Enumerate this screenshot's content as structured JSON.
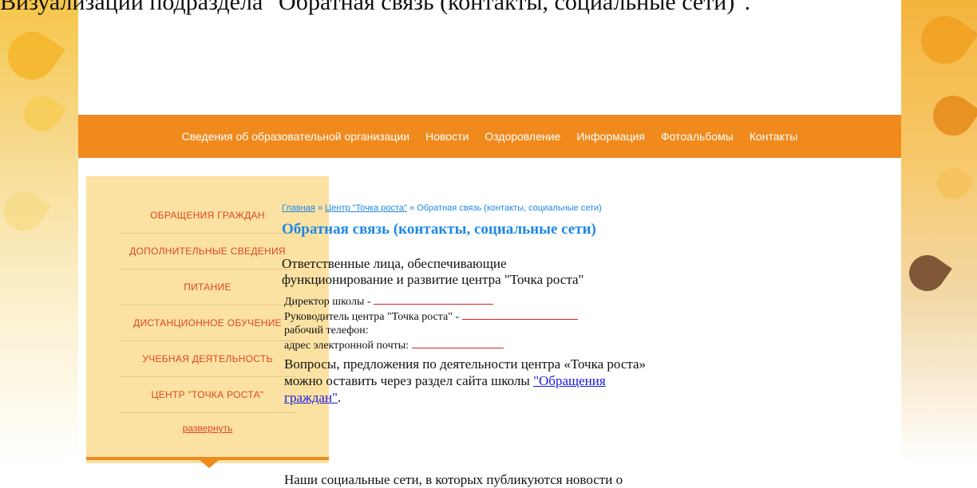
{
  "doc_caption": "Визуализации подраздела \"Обратная связь (контакты, социальные сети)\".",
  "nav": {
    "items": [
      "Сведения об образовательной организации",
      "Новости",
      "Оздоровление",
      "Информация",
      "Фотоальбомы",
      "Контакты"
    ]
  },
  "sidebar": {
    "items": [
      "ОБРАЩЕНИЯ ГРАЖДАН",
      "ДОПОЛНИТЕЛЬНЫЕ СВЕДЕНИЯ",
      "ПИТАНИЕ",
      "ДИСТАНЦИОННОЕ ОБУЧЕНИЕ",
      "УЧЕБНАЯ ДЕЯТЕЛЬНОСТЬ",
      "ЦЕНТР \"ТОЧКА РОСТА\""
    ],
    "expand_label": "развернуть"
  },
  "breadcrumb": {
    "home": "Главная",
    "sep": "»",
    "center": "Центр \"Точка роста\"",
    "current": "Обратная связь (контакты, социальные сети)"
  },
  "page_title": "Обратная связь (контакты, социальные сети)",
  "intro": "Ответственные лица, обеспечивающие функционирование и  развитие центра \"Точка роста\"",
  "contacts": {
    "director": "Директор школы -",
    "head": "Руководитель центра \"Точка роста\" -",
    "phone": "рабочий телефон:",
    "email": "адрес электронной почты:"
  },
  "questions": {
    "text": "Вопросы, предложения по деятельности центра «Точка роста» можно оставить через раздел сайта школы",
    "link": "\"Обращения граждан\"",
    "end": "."
  },
  "social_text": "Наши социальные сети, в которых публикуются новости о",
  "colors": {
    "accent": "#f08a1d",
    "link": "#1e88e5",
    "sidebar_bg": "#fbe2a3",
    "sidebar_text": "#e0461c"
  }
}
